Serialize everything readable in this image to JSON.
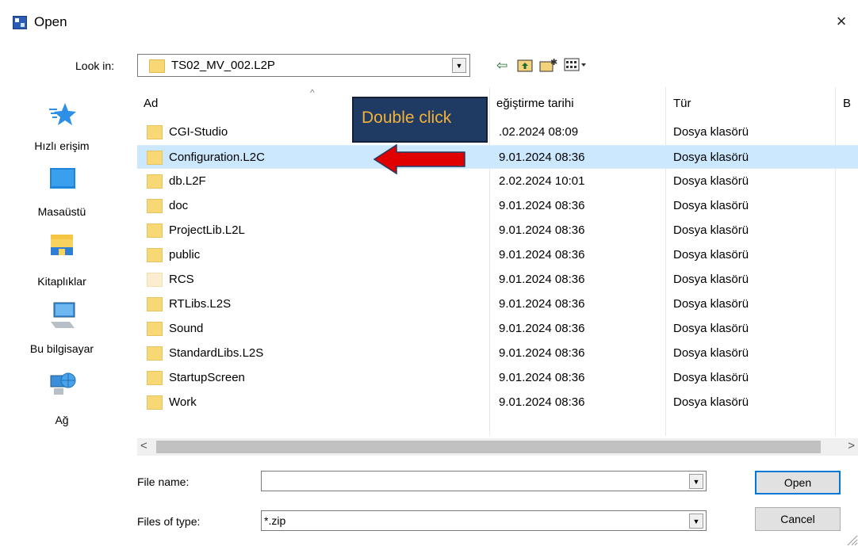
{
  "window": {
    "title": "Open",
    "close_icon": "×"
  },
  "lookin": {
    "label": "Look in:",
    "value": "TS02_MV_002.L2P"
  },
  "toolbar": {
    "back_icon": "⇦",
    "up_icon": "⬆",
    "new_folder_icon": "✱",
    "view_icon": "▦"
  },
  "places": [
    {
      "label": "Hızlı erişim",
      "icon": "star-icon"
    },
    {
      "label": "Masaüstü",
      "icon": "desktop-icon"
    },
    {
      "label": "Kitaplıklar",
      "icon": "libraries-icon"
    },
    {
      "label": "Bu bilgisayar",
      "icon": "computer-icon"
    },
    {
      "label": "Ağ",
      "icon": "network-icon"
    }
  ],
  "columns": {
    "name": "Ad",
    "date": "eğiştirme tarihi",
    "type": "Tür",
    "extra": "B"
  },
  "files": [
    {
      "name": "CGI-Studio",
      "date": ".02.2024 08:09",
      "type": "Dosya klasörü"
    },
    {
      "name": "Configuration.L2C",
      "date": "9.01.2024 08:36",
      "type": "Dosya klasörü"
    },
    {
      "name": "db.L2F",
      "date": "2.02.2024 10:01",
      "type": "Dosya klasörü"
    },
    {
      "name": "doc",
      "date": "9.01.2024 08:36",
      "type": "Dosya klasörü"
    },
    {
      "name": "ProjectLib.L2L",
      "date": "9.01.2024 08:36",
      "type": "Dosya klasörü"
    },
    {
      "name": "public",
      "date": "9.01.2024 08:36",
      "type": "Dosya klasörü"
    },
    {
      "name": "RCS",
      "date": "9.01.2024 08:36",
      "type": "Dosya klasörü"
    },
    {
      "name": "RTLibs.L2S",
      "date": "9.01.2024 08:36",
      "type": "Dosya klasörü"
    },
    {
      "name": "Sound",
      "date": "9.01.2024 08:36",
      "type": "Dosya klasörü"
    },
    {
      "name": "StandardLibs.L2S",
      "date": "9.01.2024 08:36",
      "type": "Dosya klasörü"
    },
    {
      "name": "StartupScreen",
      "date": "9.01.2024 08:36",
      "type": "Dosya klasörü"
    },
    {
      "name": "Work",
      "date": "9.01.2024 08:36",
      "type": "Dosya klasörü"
    }
  ],
  "annotation": {
    "text": "Double click",
    "box_color": "#1f3b64",
    "text_color": "#f3b23a",
    "arrow_color": "#e00000"
  },
  "filename": {
    "label": "File name:",
    "value": ""
  },
  "filetype": {
    "label": "Files of type:",
    "value": "*.zip"
  },
  "buttons": {
    "open": "Open",
    "cancel": "Cancel"
  },
  "colors": {
    "selection": "#cce8ff",
    "folder": "#f8d775",
    "accent": "#0078d7"
  }
}
